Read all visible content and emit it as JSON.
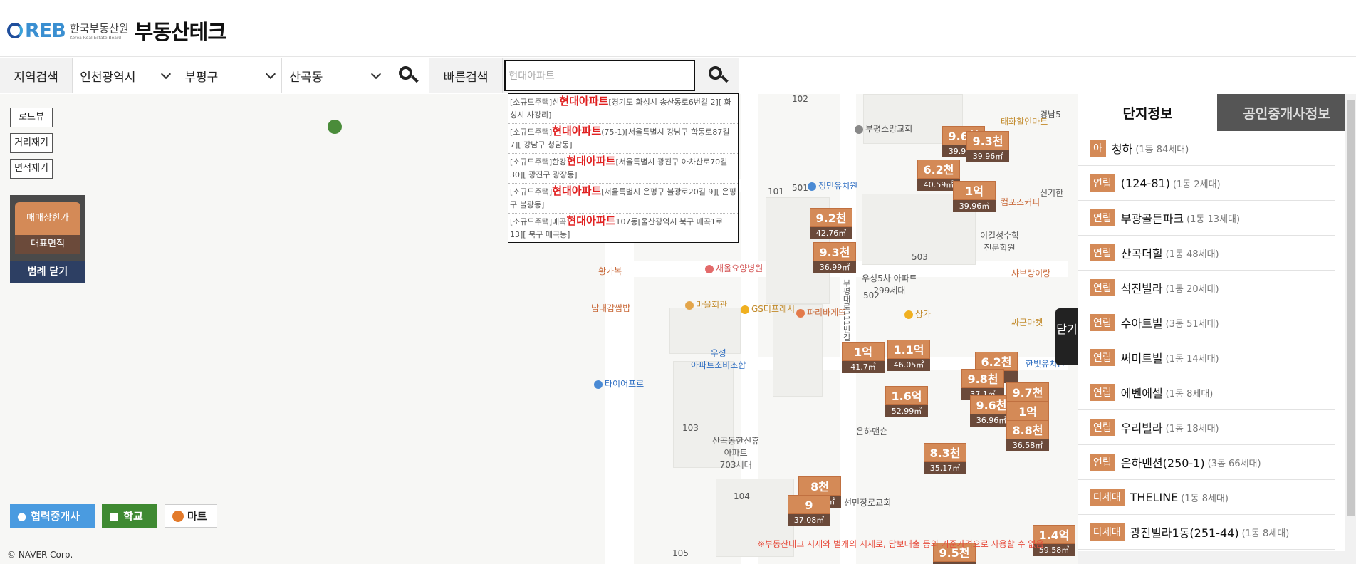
{
  "header": {
    "logo_reb": "REB",
    "logo_org_ko": "한국부동산원",
    "logo_org_en": "Korea Real Estate Board",
    "brand": "부동산테크"
  },
  "search": {
    "region_label": "지역검색",
    "city": "인천광역시",
    "district": "부평구",
    "dong": "산곡동",
    "quick_label": "빠른검색",
    "quick_value": "현대아파트"
  },
  "dropdown": [
    {
      "pre": "[소규모주택]신",
      "hl": "현대아파트",
      "post": "[경기도 화성시 송산동로6번길 2][ 화성시 사강리]"
    },
    {
      "pre": "[소규모주택]",
      "hl": "현대아파트",
      "post": "(75-1)[서울특별시 강남구 학동로87길 7][ 강남구 청담동]"
    },
    {
      "pre": "[소규모주택]한강",
      "hl": "현대아파트",
      "post": "[서울특별시 광진구 아차산로70길 30][ 광진구 광장동]"
    },
    {
      "pre": "[소규모주택]",
      "hl": "현대아파트",
      "post": "[서울특별시 은평구 불광로20길 9][ 은평구 불광동]"
    },
    {
      "pre": "[소규모주택]매곡",
      "hl": "현대아파트",
      "post": "107동[울산광역시 북구 매곡1로 13][ 북구 매곡동]"
    }
  ],
  "map_tools": {
    "roadview": "로드뷰",
    "distance": "거리재기",
    "area": "면적재기"
  },
  "legend": {
    "price": "매매상한가",
    "area": "대표면적",
    "close": "범례 닫기"
  },
  "bottom_tools": {
    "agents": "협력중개사",
    "school": "학교",
    "mart": "마트"
  },
  "copyright": "© NAVER Corp.",
  "disclaimer": "※부동산테크 시세와 별개의 시세로, 담보대출 등의 기준가격으로 사용할 수 없음",
  "map_labels": {
    "church": "부평소망교회",
    "kindergarten": "정민유치원",
    "hospital": "새올요양병원",
    "hall": "마을회관",
    "gs": "GS더프레시",
    "paris": "파리바게뜨",
    "woosung": "우성5차 아파트",
    "woosung_units": "299세대",
    "sangga": "상가",
    "coop1": "우성",
    "coop2": "아파트소비조합",
    "tire": "타이어프로",
    "hwangga": "황가복",
    "namdae": "남대감쌈밥",
    "sangok1": "산곡동한신휴",
    "sangok2": "아파트",
    "sangok3": "703세대",
    "church2": "선민장로교회",
    "eunha": "은하맨숀",
    "compose": "컴포즈커피",
    "taehwa": "태화할인마트",
    "leegil1": "이길성수학",
    "leegil2": "전문학원",
    "shabu": "샤브랑이랑",
    "ssagun": "싸군마켓",
    "hanbit": "한빛유치원",
    "singi": "신기한",
    "gyeongin": "경남5",
    "road": "부평대로111번길",
    "b101": "101",
    "b102": "102",
    "b103": "103",
    "b104": "104",
    "b105": "105",
    "b501": "501",
    "b502": "502",
    "b503": "503"
  },
  "prices": [
    {
      "p": "9.6천",
      "a": "39.96㎡"
    },
    {
      "p": "9.3천",
      "a": "39.96㎡"
    },
    {
      "p": "6.2천",
      "a": "40.59㎡"
    },
    {
      "p": "1억",
      "a": "39.96㎡"
    },
    {
      "p": "9.2천",
      "a": "42.76㎡"
    },
    {
      "p": "9.3천",
      "a": "36.99㎡"
    },
    {
      "p": "1억",
      "a": "41.7㎡"
    },
    {
      "p": "1.1억",
      "a": "46.05㎡"
    },
    {
      "p": "6.2천",
      "a": ""
    },
    {
      "p": "9.8천",
      "a": "37.1㎡"
    },
    {
      "p": "1.6억",
      "a": "52.99㎡"
    },
    {
      "p": "9.6천",
      "a": "36.96㎡"
    },
    {
      "p": "9.7천",
      "a": ""
    },
    {
      "p": "1억",
      "a": ""
    },
    {
      "p": "8.8천",
      "a": "36.58㎡"
    },
    {
      "p": "8.3천",
      "a": "35.17㎡"
    },
    {
      "p": "8천",
      "a": "31.93㎡"
    },
    {
      "p": "9",
      "a": "37.08㎡"
    },
    {
      "p": "1.4억",
      "a": "59.58㎡"
    },
    {
      "p": "9.5천",
      "a": ""
    }
  ],
  "panel": {
    "tab_complex": "단지정보",
    "tab_agent": "공인중개사정보",
    "close": "닫기",
    "rows": [
      {
        "type": "아",
        "name": "청하",
        "count": "(1동 84세대)"
      },
      {
        "type": "연립",
        "name": "(124-81)",
        "count": "(1동 2세대)"
      },
      {
        "type": "연립",
        "name": "부광골든파크",
        "count": "(1동 13세대)"
      },
      {
        "type": "연립",
        "name": "산곡더힐",
        "count": "(1동 48세대)"
      },
      {
        "type": "연립",
        "name": "석진빌라",
        "count": "(1동 20세대)"
      },
      {
        "type": "연립",
        "name": "수아트빌",
        "count": "(3동 51세대)"
      },
      {
        "type": "연립",
        "name": "써미트빌",
        "count": "(1동 14세대)"
      },
      {
        "type": "연립",
        "name": "에벤에셀",
        "count": "(1동 8세대)"
      },
      {
        "type": "연립",
        "name": "우리빌라",
        "count": "(1동 18세대)"
      },
      {
        "type": "연립",
        "name": "은하맨션(250-1)",
        "count": "(3동 66세대)"
      },
      {
        "type": "다세대",
        "name": "THELINE",
        "count": "(1동 8세대)"
      },
      {
        "type": "다세대",
        "name": "광진빌라1동(251-44)",
        "count": "(1동 8세대)"
      }
    ]
  }
}
